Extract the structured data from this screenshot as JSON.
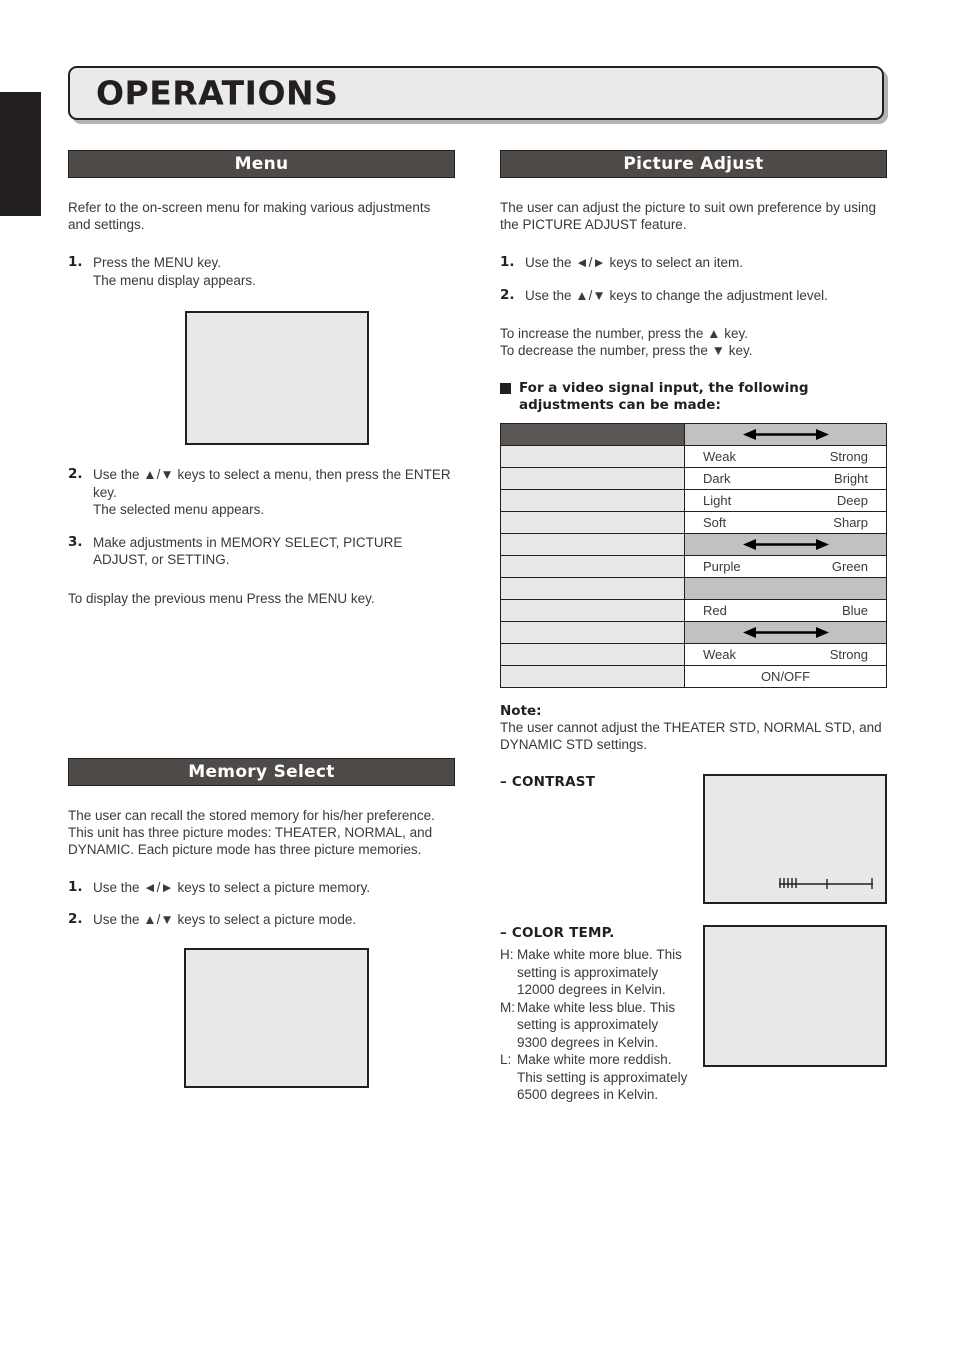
{
  "page": {
    "title": "OPERATIONS"
  },
  "left_column": {
    "menu_section": {
      "heading": "Menu",
      "intro": "Refer to the on-screen menu for making various adjustments and settings.",
      "steps": [
        {
          "num": "1.",
          "text": "Press the MENU key.\nThe menu display appears."
        },
        {
          "num": "2.",
          "text": "Use the ▲/▼ keys to select a menu, then press the ENTER key.\nThe selected menu appears."
        },
        {
          "num": "3.",
          "text": "Make adjustments in MEMORY SELECT, PICTURE ADJUST, or SETTING."
        }
      ],
      "screenshot_caption": "",
      "closing": "To display the previous menu Press the MENU key."
    },
    "memory_select_section": {
      "heading": "Memory Select",
      "intro": "The user can recall the stored memory for his/her preference. This unit has three picture modes: THEATER, NORMAL, and DYNAMIC. Each picture mode has three picture memories.",
      "steps": [
        {
          "num": "1.",
          "text": "Use the ◄/► keys to select a picture memory."
        },
        {
          "num": "2.",
          "text": "Use the ▲/▼ keys to select a picture mode."
        }
      ]
    }
  },
  "right_column": {
    "picture_adjust_section": {
      "heading": "Picture Adjust",
      "intro": "The user can adjust the picture to suit own preference by using the PICTURE ADJUST feature.",
      "steps": [
        {
          "num": "1.",
          "text": "Use the ◄/► keys to select an item."
        },
        {
          "num": "2.",
          "text": "Use the ▲/▼ keys to change the adjustment level."
        }
      ],
      "increase_line": "To increase the number, press the ▲ key.",
      "decrease_line": "To decrease the number, press the ▼ key.",
      "bullet_heading": "For a video signal input, the following adjustments can be made:",
      "table": {
        "rows": [
          {
            "type": "arrow",
            "label": "",
            "label_style": "dark",
            "left": "",
            "right": ""
          },
          {
            "type": "values",
            "label": "",
            "label_style": "light",
            "left": "Weak",
            "right": "Strong"
          },
          {
            "type": "values",
            "label": "",
            "label_style": "light",
            "left": "Dark",
            "right": "Bright"
          },
          {
            "type": "values",
            "label": "",
            "label_style": "light",
            "left": "Light",
            "right": "Deep"
          },
          {
            "type": "values",
            "label": "",
            "label_style": "light",
            "left": "Soft",
            "right": "Sharp"
          },
          {
            "type": "arrow",
            "label": "",
            "label_style": "light",
            "left": "",
            "right": ""
          },
          {
            "type": "values",
            "label": "",
            "label_style": "light",
            "left": "Purple",
            "right": "Green"
          },
          {
            "type": "blank",
            "label": "",
            "label_style": "light",
            "left": "",
            "right": ""
          },
          {
            "type": "values",
            "label": "",
            "label_style": "light",
            "left": "Red",
            "right": "Blue"
          },
          {
            "type": "arrow",
            "label": "",
            "label_style": "light",
            "left": "",
            "right": ""
          },
          {
            "type": "values",
            "label": "",
            "label_style": "light",
            "left": "Weak",
            "right": "Strong"
          },
          {
            "type": "center",
            "label": "",
            "label_style": "light",
            "center": "ON/OFF"
          }
        ]
      },
      "note_label": "Note:",
      "note_text": "The user cannot adjust the THEATER STD, NORMAL STD, and DYNAMIC STD settings.",
      "contrast": {
        "heading": "– CONTRAST"
      },
      "color_temp": {
        "heading": "– COLOR TEMP.",
        "definitions": [
          {
            "key": "H:",
            "text": "Make white more blue. This setting is approximately 12000 degrees in Kelvin."
          },
          {
            "key": "M:",
            "text": "Make white less blue. This setting is approximately 9300 degrees in Kelvin."
          },
          {
            "key": "L:",
            "text": "Make white more reddish. This setting is approximately 6500 degrees in Kelvin."
          }
        ]
      }
    }
  },
  "colors": {
    "section_bar_bg": "#4d4a48",
    "banner_bg": "#eaeaea",
    "shot_bg": "#e8e8e8",
    "table_label_bg": "#e8e8e8",
    "table_label_dark_bg": "#595654",
    "table_arrow_bg": "#c3c1c0",
    "ink": "#231f20"
  }
}
